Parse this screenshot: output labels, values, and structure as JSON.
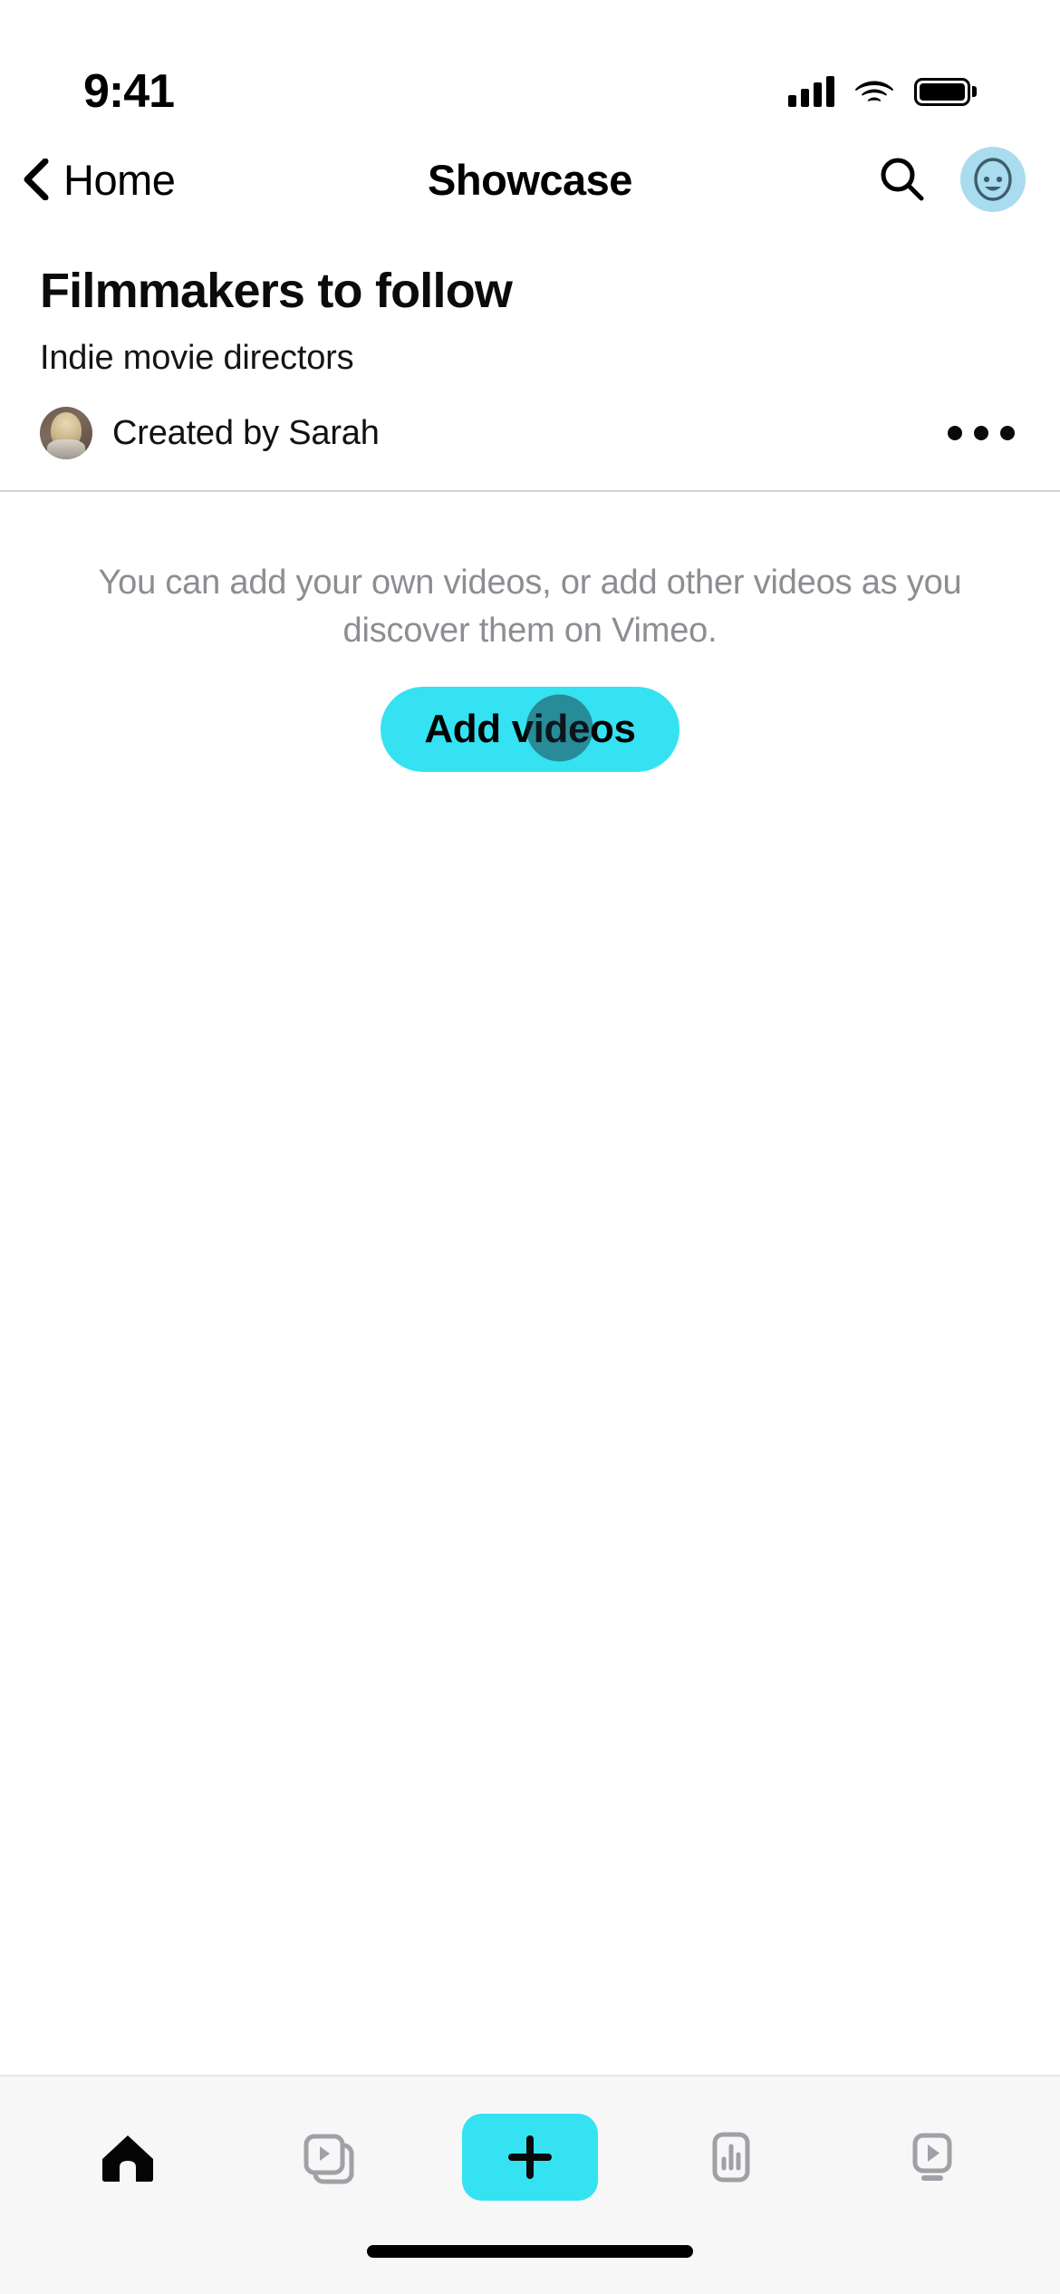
{
  "status_bar": {
    "time": "9:41",
    "cellular_icon": "cellular-signal-icon",
    "wifi_icon": "wifi-icon",
    "battery_icon": "battery-full-icon"
  },
  "nav_bar": {
    "back_label": "Home",
    "back_icon": "chevron-left-icon",
    "title": "Showcase",
    "search_icon": "search-icon",
    "avatar_icon": "user-avatar-face-icon"
  },
  "showcase": {
    "title": "Filmmakers to follow",
    "subtitle": "Indie movie directors",
    "creator": "Created by Sarah",
    "creator_avatar": "creator-photo-avatar",
    "more_icon": "more-horizontal-icon"
  },
  "empty_state": {
    "message": "You can add your own videos, or add other videos as you discover them on Vimeo.",
    "add_button_label": "Add videos"
  },
  "tab_bar": {
    "items": [
      {
        "name": "home",
        "icon": "home-icon",
        "active": true
      },
      {
        "name": "library",
        "icon": "video-library-stack-icon",
        "active": false
      },
      {
        "name": "create",
        "icon": "plus-icon",
        "active": false
      },
      {
        "name": "analytics",
        "icon": "bar-chart-icon",
        "active": false
      },
      {
        "name": "watch",
        "icon": "tv-play-icon",
        "active": false
      }
    ]
  },
  "colors": {
    "accent_cyan": "#35e2f2",
    "muted_text": "#8d8d92",
    "tab_inactive": "#a0a0a6",
    "tab_bar_bg": "#f7f7f8",
    "divider": "#d2d2d4",
    "avatar_bg": "#a9dcef"
  }
}
